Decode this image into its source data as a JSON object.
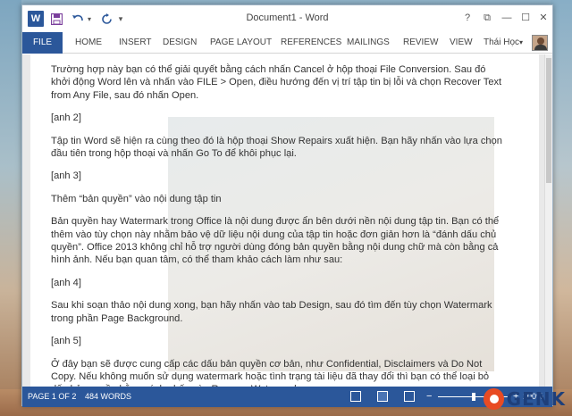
{
  "window": {
    "title": "Document1 - Word",
    "app_icon": "W",
    "controls": {
      "help": "?",
      "ribbon_display": "⧉",
      "minimize": "—",
      "maximize": "☐",
      "close": "✕"
    }
  },
  "quick_access": {
    "save_icon": "save-icon",
    "undo_icon": "undo-icon",
    "redo_icon": "redo-icon"
  },
  "ribbon": {
    "file_tab": "FILE",
    "tabs": [
      "HOME",
      "INSERT",
      "DESIGN",
      "PAGE LAYOUT",
      "REFERENCES",
      "MAILINGS",
      "REVIEW",
      "VIEW"
    ],
    "user_name": "Thái Học"
  },
  "document": {
    "paragraphs": [
      "Trường hợp này bạn có thể giải quyết bằng cách nhấn Cancel ở hộp thoại File Conversion. Sau đó khởi động Word lên và nhấn vào FILE > Open, điều hướng đến vị trí tập tin bị lỗi và chọn Recover Text from Any File, sau đó nhấn Open.",
      "[anh 2]",
      "Tập tin Word sẽ hiện ra cùng theo đó là hộp thoại Show Repairs xuất hiện. Bạn hãy nhấn vào lựa chọn đầu tiên trong hộp thoại và nhấn Go To để khôi phục lại.",
      "[anh 3]",
      "Thêm “bản quyền” vào nội dung tập tin",
      "Bản quyền hay Watermark trong Office là nội dung được ẩn bên dưới nền nội dung tập tin. Bạn có thể thêm vào tùy chọn này nhằm bảo vệ dữ liệu nội dung của tập tin hoặc đơn giản hơn là “đánh dấu chủ quyền”. Office 2013 không chỉ hỗ trợ người dùng đóng bản quyền bằng nội dung chữ mà còn bằng cả hình ảnh. Nếu bạn quan tâm, có thể tham khảo cách làm như sau:",
      "[anh 4]",
      "Sau khi soạn thảo nội dung xong, bạn hãy nhấn vào tab Design, sau đó tìm đến tùy chọn Watermark trong phần Page Background.",
      "[anh 5]",
      "Ở đây bạn sẽ được cung cấp các dấu bản quyền cơ bản, như Confidential, Disclaimers và Do Not Copy. Nếu không muốn sử dụng watermark hoặc tình trạng tài liệu đã thay đổi thì bạn có thể loại bỏ dấu bản quyền bằng cách nhấn vào Remove Watermark."
    ]
  },
  "status": {
    "page": "PAGE 1 OF 2",
    "words": "484 WORDS",
    "zoom": "100%",
    "zoom_minus": "−",
    "zoom_plus": "+"
  },
  "logo": {
    "text": "GENK"
  },
  "colors": {
    "accent": "#2b579a",
    "logo_orange": "#e84b23",
    "logo_blue": "#1e3f7a"
  }
}
